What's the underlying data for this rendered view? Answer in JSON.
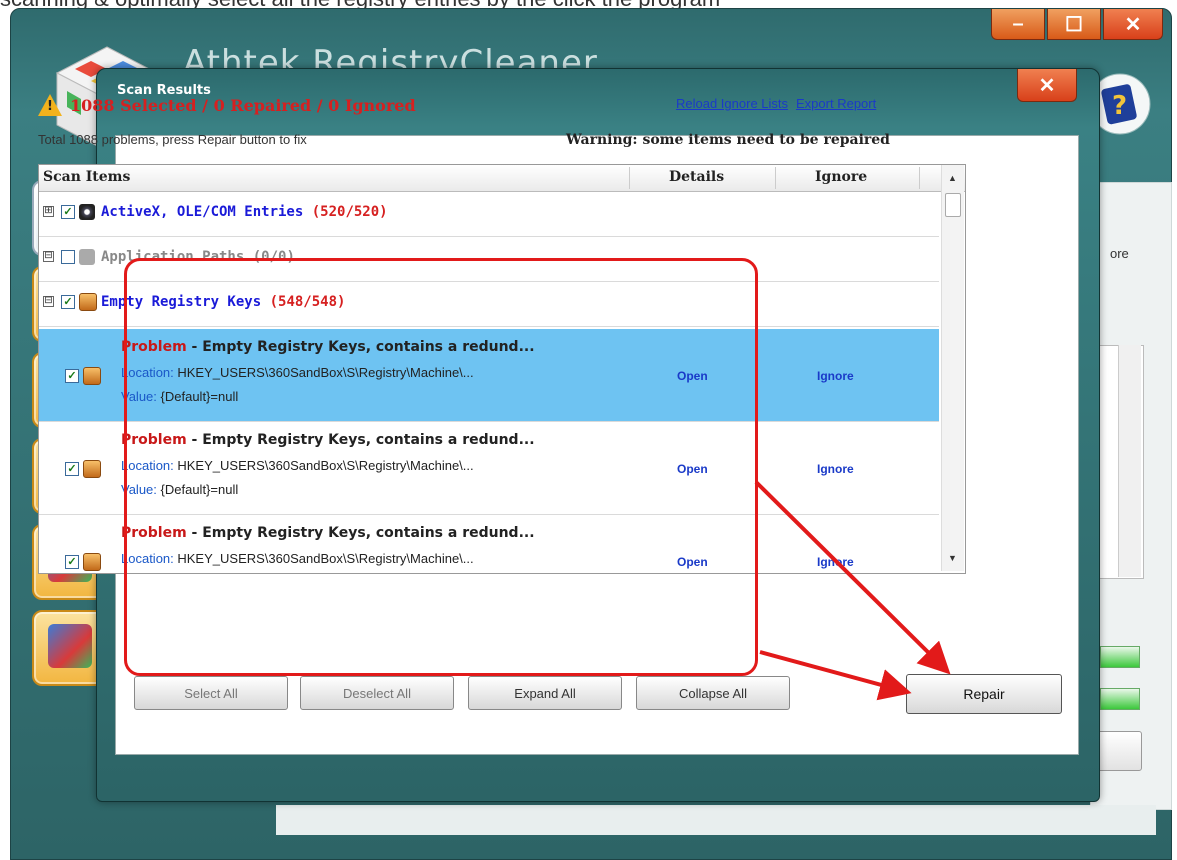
{
  "top_caption": "scanning & optimally select all the registry entries by the click the program",
  "app": {
    "title": "Athtek RegistryCleaner",
    "window_buttons": {
      "minimize": "–",
      "maximize": "☐",
      "close": "✕"
    },
    "right_panel_text": "ore"
  },
  "dialog": {
    "title": "Scan Results",
    "close_label": "✕",
    "summary": "1088 Selected / 0 Repaired / 0 Ignored",
    "links": {
      "reload": "Reload Ignore Lists",
      "export": "Export Report"
    },
    "subline": "Total 1088 problems, press Repair button to fix",
    "warning": "Warning: some items need to be repaired",
    "columns": {
      "items": "Scan Items",
      "details": "Details",
      "ignore": "Ignore"
    },
    "categories": [
      {
        "label": "ActiveX, OLE/COM Entries",
        "count": "(520/520)",
        "expander": "⊞",
        "checked": true
      },
      {
        "label": "Application Paths",
        "count": "(0/0)",
        "expander": "⊟",
        "checked": false
      },
      {
        "label": "Empty Registry Keys",
        "count": "(548/548)",
        "expander": "⊟",
        "checked": true
      }
    ],
    "items": [
      {
        "problem_label": "Problem",
        "problem_text": " - Empty Registry Keys, contains a redund...",
        "location_label": "Location:",
        "location_text": " HKEY_USERS\\360SandBox\\S\\Registry\\Machine\\...",
        "value_label": "Value:",
        "value_text": " {Default}=null",
        "open": "Open",
        "ignore": "Ignore",
        "selected": true
      },
      {
        "problem_label": "Problem",
        "problem_text": " - Empty Registry Keys, contains a redund...",
        "location_label": "Location:",
        "location_text": " HKEY_USERS\\360SandBox\\S\\Registry\\Machine\\...",
        "value_label": "Value:",
        "value_text": " {Default}=null",
        "open": "Open",
        "ignore": "Ignore",
        "selected": false
      },
      {
        "problem_label": "Problem",
        "problem_text": " - Empty Registry Keys, contains a redund...",
        "location_label": "Location:",
        "location_text": " HKEY_USERS\\360SandBox\\S\\Registry\\Machine\\...",
        "open": "Open",
        "ignore": "Ignore",
        "selected": false
      }
    ],
    "buttons": {
      "select_all": "Select All",
      "deselect_all": "Deselect All",
      "expand_all": "Expand All",
      "collapse_all": "Collapse All",
      "repair": "Repair"
    }
  },
  "colors": {
    "highlight": "#e21a1a",
    "selected_row": "#6ec3f2",
    "accent_title": "#2f6b6e"
  }
}
